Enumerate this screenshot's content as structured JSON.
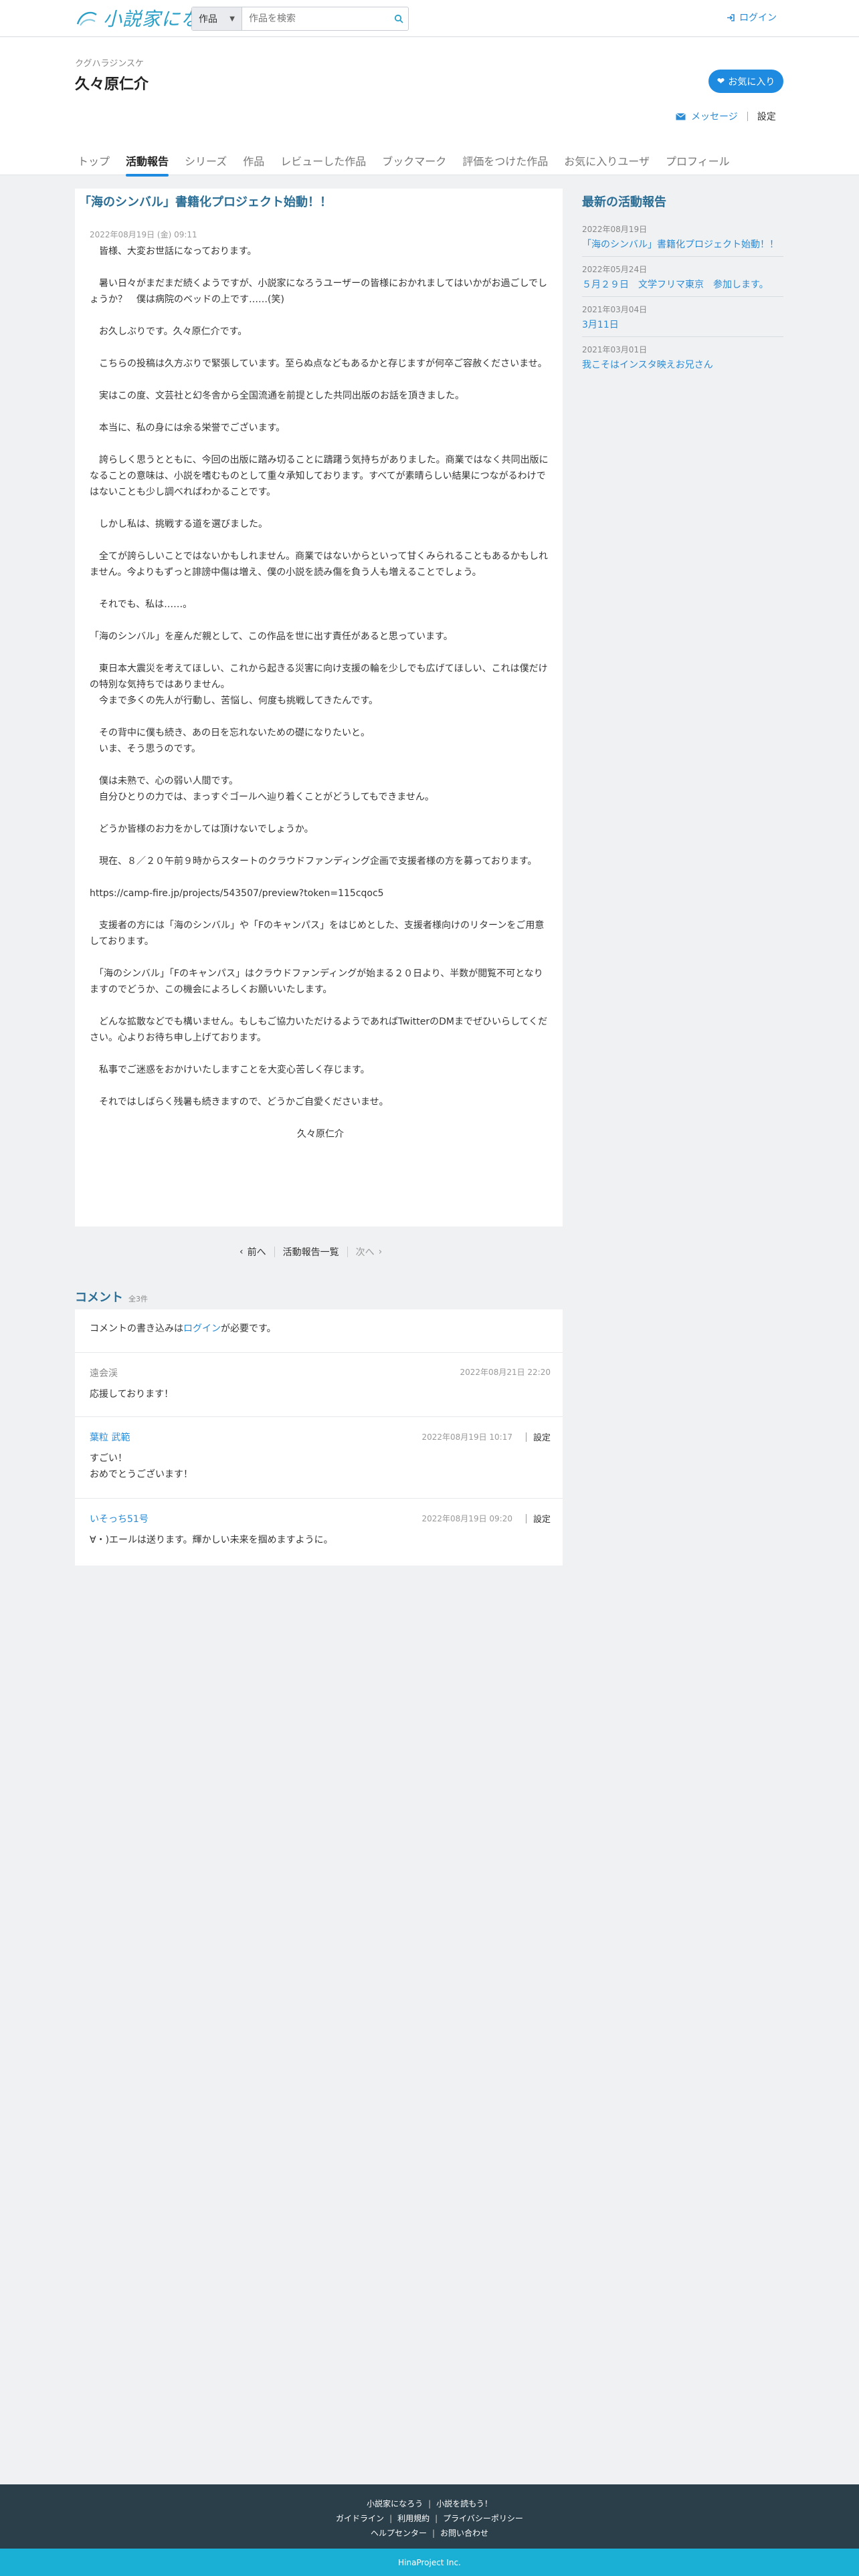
{
  "header": {
    "logo_text": "小説家になろう",
    "search_select": "作品",
    "search_placeholder": "作品を検索",
    "login_label": "ログイン"
  },
  "user": {
    "kana": "クグハラジンスケ",
    "name": "久々原仁介",
    "fav_button": "お気に入り",
    "message_link": "メッセージ",
    "settings_link": "設定"
  },
  "tabs": [
    {
      "label": "トップ"
    },
    {
      "label": "活動報告"
    },
    {
      "label": "シリーズ"
    },
    {
      "label": "作品"
    },
    {
      "label": "レビューした作品"
    },
    {
      "label": "ブックマーク"
    },
    {
      "label": "評価をつけた作品"
    },
    {
      "label": "お気に入りユーザ"
    },
    {
      "label": "プロフィール"
    }
  ],
  "article": {
    "title": "「海のシンバル」書籍化プロジェクト始動！！",
    "date": "2022年08月19日 (金) 09:11",
    "paragraphs": [
      "　皆様、大変お世話になっております。",
      "　暑い日々がまだまだ続くようですが、小説家になろうユーザーの皆様におかれましてはいかがお過ごしでしょうか？　僕は病院のベッドの上です……(笑)",
      "　お久しぶりです。久々原仁介です。",
      "　こちらの投稿は久方ぶりで緊張しています。至らぬ点などもあるかと存じますが何卒ご容赦くださいませ。",
      "　実はこの度、文芸社と幻冬舎から全国流通を前提とした共同出版のお話を頂きました。",
      "　本当に、私の身には余る栄誉でございます。",
      "　誇らしく思うとともに、今回の出版に踏み切ることに躊躇う気持ちがありました。商業ではなく共同出版になることの意味は、小説を嗜むものとして重々承知しております。すべてが素晴らしい結果につながるわけではないことも少し調べればわかることです。",
      "　しかし私は、挑戦する道を選びました。",
      "　全てが誇らしいことではないかもしれません。商業ではないからといって甘くみられることもあるかもしれません。今よりもずっと誹謗中傷は増え、僕の小説を読み傷を負う人も増えることでしょう。",
      "　それでも、私は……。",
      "「海のシンバル」を産んだ親として、この作品を世に出す責任があると思っています。",
      "　東日本大震災を考えてほしい、これから起きる災害に向け支援の輪を少しでも広げてほしい、これは僕だけの特別な気持ちではありません。\n　今まで多くの先人が行動し、苦悩し、何度も挑戦してきたんです。",
      "　その背中に僕も続き、あの日を忘れないための礎になりたいと。\n　いま、そう思うのです。",
      "　僕は未熟で、心の弱い人間です。\n　自分ひとりの力では、まっすぐゴールへ辿り着くことがどうしてもできません。",
      "　どうか皆様のお力をかしては頂けないでしょうか。",
      "　現在、８／２０午前９時からスタートのクラウドファンディング企画で支援者様の方を募っております。",
      "https://camp-fire.jp/projects/543507/preview?token=115cqoc5",
      "　支援者の方には「海のシンバル」や「Fのキャンパス」をはじめとした、支援者様向けのリターンをご用意しております。",
      "　「海のシンバル」「Fのキャンパス」はクラウドファンディングが始まる２０日より、半数が閲覧不可となりますのでどうか、この機会によろしくお願いいたします。",
      "　どんな拡散などでも構いません。もしもご協力いただけるようであればTwitterのDMまでぜひいらしてください。心よりお待ち申し上げております。",
      "　私事でご迷惑をおかけいたしますことを大変心苦しく存じます。",
      "　それではしばらく残暑も続きますので、どうかご自愛くださいませ。"
    ],
    "signature": "久々原仁介"
  },
  "pager": {
    "prev": "前へ",
    "list": "活動報告一覧",
    "next": "次へ"
  },
  "comments": {
    "heading": "コメント",
    "count": "全3件",
    "note_prefix": "コメントの書き込みは",
    "note_link": "ログイン",
    "note_suffix": "が必要です。",
    "items": [
      {
        "who": "遠会渓",
        "date": "2022年08月21日 22:20",
        "text": "応援しております！",
        "settings": ""
      },
      {
        "who": "葉粒 武範",
        "date": "2022年08月19日 10:17",
        "text": "すごい！\nおめでとうございます！",
        "settings": "設定"
      },
      {
        "who": "いそっち51号",
        "date": "2022年08月19日 09:20",
        "text": "∀・)エールは送ります。輝かしい未来を掴めますように。",
        "settings": "設定"
      }
    ]
  },
  "sidebar": {
    "heading": "最新の活動報告",
    "items": [
      {
        "date": "2022年08月19日",
        "label": "「海のシンバル」書籍化プロジェクト始動！！"
      },
      {
        "date": "2022年05月24日",
        "label": "５月２９日　文学フリマ東京　参加します。"
      },
      {
        "date": "2021年03月04日",
        "label": "3月11日"
      },
      {
        "date": "2021年03月01日",
        "label": "我こそはインスタ映えお兄さん"
      }
    ]
  },
  "footer": {
    "row1": [
      "小説家になろう",
      "小説を読もう！"
    ],
    "row2": [
      "ガイドライン",
      "利用規約",
      "プライバシーポリシー"
    ],
    "row3": [
      "ヘルプセンター",
      "お問い合わせ"
    ],
    "copyright": "HinaProject Inc."
  },
  "colors": {
    "accent": "#1e8ae0",
    "heading": "#2a6e96",
    "footer_dark": "#2a3f4a",
    "footer_bar": "#1ab0d6"
  }
}
